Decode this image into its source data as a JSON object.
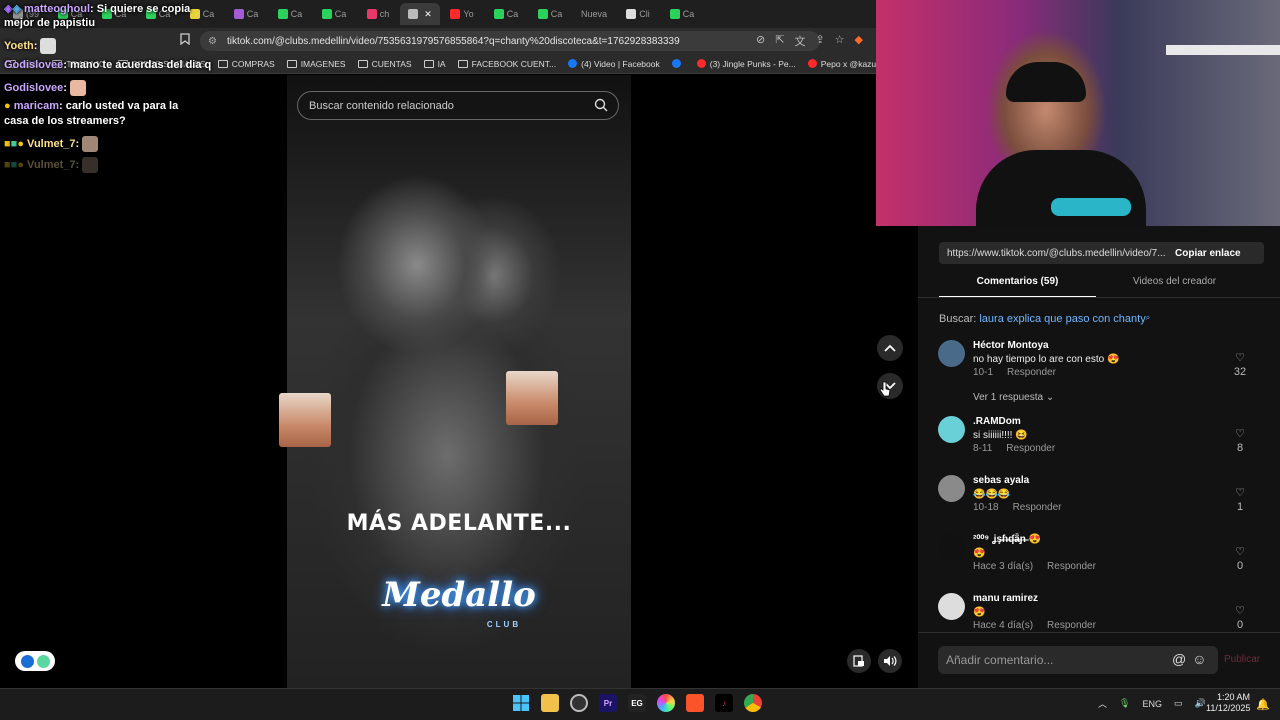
{
  "browser": {
    "tabs": [
      {
        "label": "(99",
        "color": "#999999"
      },
      {
        "label": "Ca",
        "color": "#2bd35c"
      },
      {
        "label": "Ca",
        "color": "#2bd35c"
      },
      {
        "label": "Ca",
        "color": "#2bd35c"
      },
      {
        "label": "Ca",
        "color": "#e8d23a"
      },
      {
        "label": "Ca",
        "color": "#a55bd6"
      },
      {
        "label": "Ca",
        "color": "#2bd35c"
      },
      {
        "label": "Ca",
        "color": "#2bd35c"
      },
      {
        "label": "ch",
        "color": "#e83a6a"
      },
      {
        "label": "",
        "color": "#bbbbbb"
      },
      {
        "label": "Yo",
        "color": "#ff2a2a"
      },
      {
        "label": "Ca",
        "color": "#2bd35c"
      },
      {
        "label": "Ca",
        "color": "#2bd35c"
      },
      {
        "label": "Nueva",
        "color": ""
      },
      {
        "label": "Cli",
        "color": "#dddddd"
      },
      {
        "label": "Ca",
        "color": "#2bd35c"
      }
    ],
    "url": "tiktok.com/@clubs.medellin/video/7535631979576855864?q=chanty%20discoteca&t=1762928383339",
    "bookmarks": [
      {
        "label": "Jabie",
        "icon": "folder"
      },
      {
        "label": "TRABAJO",
        "icon": "folder"
      },
      {
        "label": "REDES SOCIALES",
        "icon": "folder"
      },
      {
        "label": "COMPRAS",
        "icon": "folder"
      },
      {
        "label": "IMAGENES",
        "icon": "folder"
      },
      {
        "label": "CUENTAS",
        "icon": "folder"
      },
      {
        "label": "IA",
        "icon": "folder"
      },
      {
        "label": "FACEBOOK CUENT...",
        "icon": "folder"
      },
      {
        "label": "(4) Video | Facebook",
        "icon": "facebook"
      },
      {
        "label": "",
        "icon": "facebook"
      },
      {
        "label": "(3) Jingle Punks - Pe...",
        "icon": "youtube"
      },
      {
        "label": "Pepo x @kazu.oficia...",
        "icon": "youtube"
      }
    ]
  },
  "chat": {
    "messages": [
      {
        "user": "matteoghoul",
        "text": "Si quiere se copia"
      },
      {
        "user": "",
        "text": "mejor de papistiu"
      },
      {
        "user": "Yoeth",
        "text": ""
      },
      {
        "user": "Godislovee",
        "text": "mano te acuerdas del dia q"
      },
      {
        "user": "Godislovee",
        "text": ""
      },
      {
        "user": "maricam",
        "text": "carlo usted va para la"
      },
      {
        "user": "",
        "text": "casa de los streamers?"
      },
      {
        "user": "Vulmet_7",
        "text": ""
      },
      {
        "user": "Vulmet_7",
        "text": ""
      }
    ]
  },
  "video": {
    "search_placeholder": "Buscar contenido relacionado",
    "caption": "MÁS ADELANTE...",
    "logo_text": "Medallo",
    "logo_sub": "CLUB"
  },
  "panel": {
    "share_url": "https://www.tiktok.com/@clubs.medellin/video/7...",
    "copy_label": "Copiar enlace",
    "tab_comments": "Comentarios (59)",
    "tab_videos": "Videos del creador",
    "search_prefix": "Buscar:",
    "search_query": "laura explica que paso con chanty",
    "view_replies": "Ver 1 respuesta",
    "comments": [
      {
        "name": "Héctor Montoya",
        "text": "no hay tiempo lo are con esto 😍",
        "date": "10-1",
        "reply": "Responder",
        "likes": "32",
        "avatar_color": "#4a6a8a"
      },
      {
        "name": ".RAMDom",
        "text": "si siiiiii!!!! 😆",
        "date": "8-11",
        "reply": "Responder",
        "likes": "8",
        "avatar_color": "#6ad0d8"
      },
      {
        "name": "sebas ayala",
        "text": "😂😂😂",
        "date": "10-18",
        "reply": "Responder",
        "likes": "1",
        "avatar_color": "#8a8a8a"
      },
      {
        "name": "²⁰⁰⁹ ʝş̶ɦ̶ʠ̶ǟ̶ɲ̶ 😍",
        "text": "😍",
        "date": "Hace 3 día(s)",
        "reply": "Responder",
        "likes": "0",
        "avatar_color": "#111111"
      },
      {
        "name": "manu ramirez",
        "text": "😍",
        "date": "Hace 4 día(s)",
        "reply": "Responder",
        "likes": "0",
        "avatar_color": "#dddddd"
      }
    ],
    "comment_placeholder": "Añadir comentario...",
    "publish_label": "Publicar"
  },
  "taskbar": {
    "lang": "ENG",
    "time": "1:20 AM",
    "date": "11/12/2025"
  },
  "colors": {
    "accent_link": "#6fb6ff",
    "publish": "#6e2a3a"
  }
}
